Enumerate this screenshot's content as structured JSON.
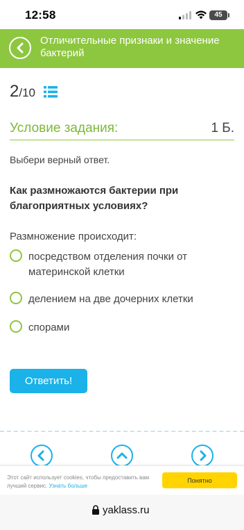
{
  "status": {
    "time": "12:58",
    "battery": "45"
  },
  "header": {
    "title": "Отличительные признаки и значение бактерий"
  },
  "progress": {
    "current": "2",
    "total": "/10"
  },
  "condition": {
    "label": "Условие задания:",
    "points": "1 Б."
  },
  "instruction": "Выбери верный ответ.",
  "question": "Как размножаются бактерии при благоприятных условиях?",
  "subquestion": "Размножение происходит:",
  "options": [
    {
      "label": "посредством отделения почки от материнской клетки"
    },
    {
      "label": "делением на две дочерних клетки"
    },
    {
      "label": "спорами"
    }
  ],
  "answer_button": "Ответить!",
  "cookie": {
    "text": "Этот сайт использует cookies, чтобы предоставить вам лучший сервис.",
    "link": "Узнать больше",
    "button": "Понятно"
  },
  "browser": {
    "url": "yaklass.ru"
  },
  "colors": {
    "accent_green": "#8dc63f",
    "accent_blue": "#1ab2e8",
    "cookie_yellow": "#ffd400"
  }
}
